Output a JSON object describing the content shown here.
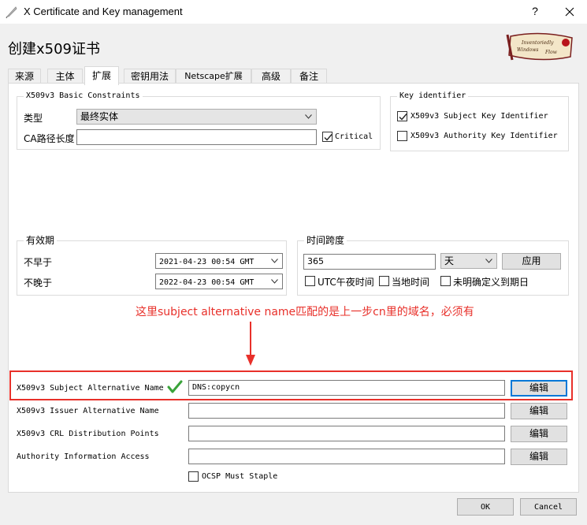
{
  "window": {
    "title": "X Certificate and Key management",
    "help_label": "?",
    "close_icon": "close-icon"
  },
  "header": {
    "title": "创建x509证书",
    "logo_text_line1": "Inventoriedly",
    "logo_text_line2": "Windows",
    "logo_text_line3": "Flow"
  },
  "tabs": [
    {
      "label": "来源"
    },
    {
      "label": "主体"
    },
    {
      "label": "扩展"
    },
    {
      "label": "密钥用法"
    },
    {
      "label": "Netscape扩展"
    },
    {
      "label": "高级"
    },
    {
      "label": "备注"
    }
  ],
  "active_tab": "扩展",
  "basic_constraints": {
    "title": "X509v3 Basic Constraints",
    "type_label": "类型",
    "type_value": "最终实体",
    "ca_path_label": "CA路径长度",
    "ca_path_value": "",
    "critical_label": "Critical",
    "critical_checked": true
  },
  "key_identifier": {
    "title": "Key identifier",
    "subject_key_label": "X509v3 Subject Key Identifier",
    "subject_key_checked": true,
    "authority_key_label": "X509v3 Authority Key Identifier",
    "authority_key_checked": false
  },
  "validity": {
    "title": "有效期",
    "not_before_label": "不早于",
    "not_before_value": "2021-04-23 00:54 GMT",
    "not_after_label": "不晚于",
    "not_after_value": "2022-04-23 00:54 GMT"
  },
  "time_range": {
    "title": "时间跨度",
    "value": "365",
    "unit": "天",
    "apply_label": "应用",
    "utc_label": "UTC午夜时间",
    "utc_checked": false,
    "local_label": "当地时间",
    "local_checked": false,
    "undefined_label": "未明确定义到期日",
    "undefined_checked": false
  },
  "annotation": {
    "text": "这里subject alternative name匹配的是上一步cn里的域名，必须有",
    "color": "#e8302a"
  },
  "extensions": [
    {
      "label": "X509v3 Subject Alternative Name",
      "value": "DNS:copycn",
      "button": "编辑",
      "valid_icon": "green-checkmark-icon"
    },
    {
      "label": "X509v3 Issuer Alternative Name",
      "value": "",
      "button": "编辑"
    },
    {
      "label": "X509v3 CRL Distribution Points",
      "value": "",
      "button": "编辑"
    },
    {
      "label": "Authority Information Access",
      "value": "",
      "button": "编辑"
    }
  ],
  "ocsp": {
    "label": "OCSP Must Staple",
    "checked": false
  },
  "footer": {
    "ok_label": "OK",
    "cancel_label": "Cancel"
  },
  "colors": {
    "accent": "#0078d7",
    "check_green": "#3aa33a",
    "annotation_red": "#e8302a"
  }
}
